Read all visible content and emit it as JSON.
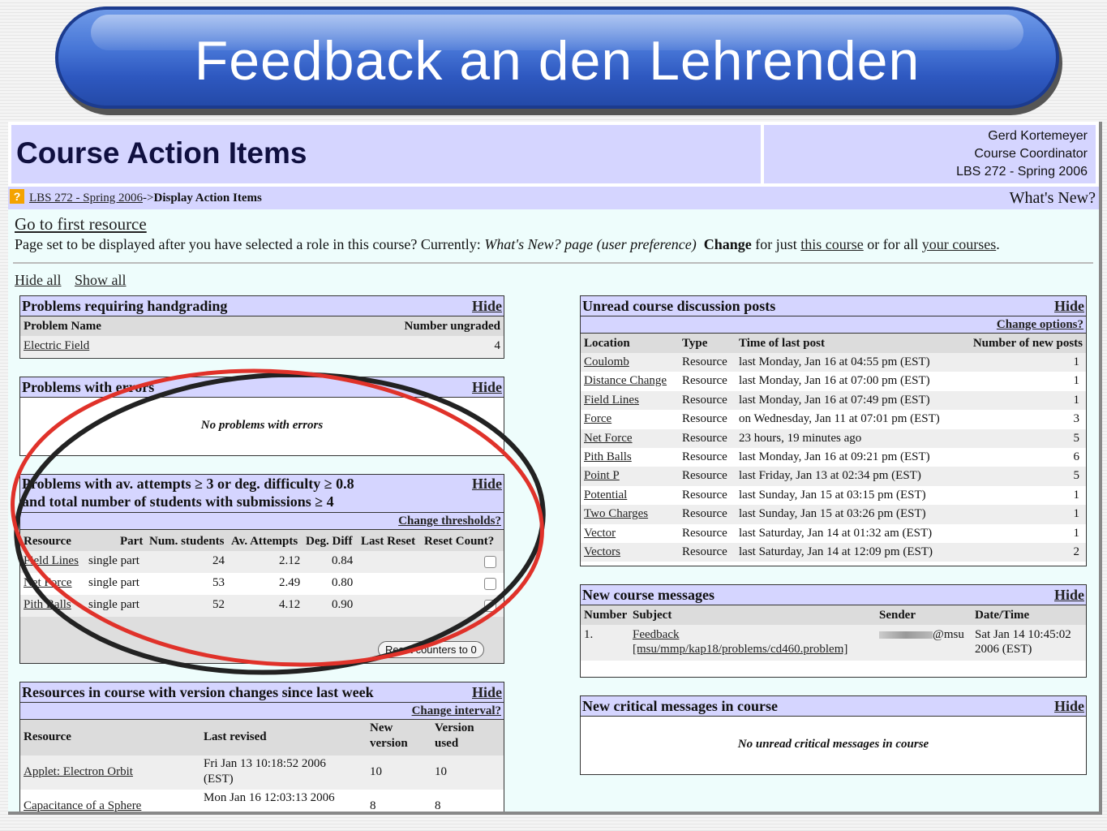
{
  "banner": {
    "title": "Feedback an den Lehrenden"
  },
  "header": {
    "title": "Course Action Items",
    "user_name": "Gerd Kortemeyer",
    "user_role": "Course Coordinator",
    "course": "LBS 272 - Spring 2006"
  },
  "breadcrumb": {
    "course_link": "LBS 272 - Spring 2006",
    "separator": "->",
    "current": "Display Action Items",
    "whats_new": "What's New?"
  },
  "intro": {
    "first_resource": "Go to first resource",
    "pageset_prefix": "Page set to be displayed after you have selected a role in this course? Currently:",
    "pageset_current": "What's New? page (user preference)",
    "change_label": "Change",
    "for_just": "for just",
    "this_course": "this course",
    "or_all": "or for all",
    "your_courses": "your courses",
    "period": "."
  },
  "controls": {
    "hide_all": "Hide all",
    "show_all": "Show all"
  },
  "handgrading": {
    "title": "Problems requiring handgrading",
    "hide": "Hide",
    "col_name": "Problem Name",
    "col_count": "Number ungraded",
    "rows": [
      {
        "name": "Electric Field",
        "count": "4"
      }
    ]
  },
  "errors": {
    "title": "Problems with errors",
    "hide": "Hide",
    "empty": "No problems with errors"
  },
  "attempts": {
    "title_line1": "Problems with av. attempts ≥ 3 or deg. difficulty ≥ 0.8",
    "title_line2": "and total number of students with submissions ≥ 4",
    "hide": "Hide",
    "change_thresholds": "Change thresholds?",
    "headers": [
      "Resource",
      "Part",
      "Num. students",
      "Av. Attempts",
      "Deg. Diff",
      "Last Reset",
      "Reset Count?"
    ],
    "rows": [
      {
        "resource": "Field Lines",
        "part": "single part",
        "students": "24",
        "attempts": "2.12",
        "diff": "0.84"
      },
      {
        "resource": "Net Force",
        "part": "single part",
        "students": "53",
        "attempts": "2.49",
        "diff": "0.80"
      },
      {
        "resource": "Pith Balls",
        "part": "single part",
        "students": "52",
        "attempts": "4.12",
        "diff": "0.90"
      }
    ],
    "reset_button": "Reset counters to 0"
  },
  "versions": {
    "title": "Resources in course with version changes since last week",
    "hide": "Hide",
    "change_interval": "Change interval?",
    "col_resource": "Resource",
    "col_revised": "Last revised",
    "col_new1": "New",
    "col_new2": "version",
    "col_used1": "Version",
    "col_used2": "used",
    "rows": [
      {
        "resource": "Applet: Electron Orbit",
        "revised1": "Fri Jan 13 10:18:52 2006",
        "revised2": "(EST)",
        "new": "10",
        "used": "10"
      },
      {
        "resource": "Capacitance of a Sphere",
        "revised1": "Mon Jan 16 12:03:13 2006",
        "revised2": "",
        "new": "8",
        "used": "8"
      }
    ]
  },
  "discussion": {
    "title": "Unread course discussion posts",
    "hide": "Hide",
    "change_options": "Change options?",
    "headers": [
      "Location",
      "Type",
      "Time of last post",
      "Number of new posts"
    ],
    "rows": [
      {
        "location": "Coulomb",
        "type": "Resource",
        "time": "last Monday, Jan 16 at 04:55 pm (EST)",
        "count": "1"
      },
      {
        "location": "Distance Change",
        "type": "Resource",
        "time": "last Monday, Jan 16 at 07:00 pm (EST)",
        "count": "1"
      },
      {
        "location": "Field Lines",
        "type": "Resource",
        "time": "last Monday, Jan 16 at 07:49 pm (EST)",
        "count": "1"
      },
      {
        "location": "Force",
        "type": "Resource",
        "time": "on Wednesday, Jan 11 at 07:01 pm (EST)",
        "count": "3"
      },
      {
        "location": "Net Force",
        "type": "Resource",
        "time": "23 hours, 19 minutes ago",
        "count": "5"
      },
      {
        "location": "Pith Balls",
        "type": "Resource",
        "time": "last Monday, Jan 16 at 09:21 pm (EST)",
        "count": "6"
      },
      {
        "location": "Point P",
        "type": "Resource",
        "time": "last Friday, Jan 13 at 02:34 pm (EST)",
        "count": "5"
      },
      {
        "location": "Potential",
        "type": "Resource",
        "time": "last Sunday, Jan 15 at 03:15 pm (EST)",
        "count": "1"
      },
      {
        "location": "Two Charges",
        "type": "Resource",
        "time": "last Sunday, Jan 15 at 03:26 pm (EST)",
        "count": "1"
      },
      {
        "location": "Vector",
        "type": "Resource",
        "time": "last Saturday, Jan 14 at 01:32 am (EST)",
        "count": "1"
      },
      {
        "location": "Vectors",
        "type": "Resource",
        "time": "last Saturday, Jan 14 at 12:09 pm (EST)",
        "count": "2"
      }
    ]
  },
  "messages": {
    "title": "New course messages",
    "hide": "Hide",
    "headers": [
      "Number",
      "Subject",
      "Sender",
      "Date/Time"
    ],
    "rows": [
      {
        "number": "1.",
        "subject1": "Feedback",
        "subject2": "[msu/mmp/kap18/problems/cd460.problem]",
        "sender": "@msu",
        "date1": "Sat Jan 14 10:45:02",
        "date2": "2006 (EST)"
      }
    ]
  },
  "critical": {
    "title": "New critical messages in course",
    "hide": "Hide",
    "empty": "No unread critical messages in course"
  }
}
